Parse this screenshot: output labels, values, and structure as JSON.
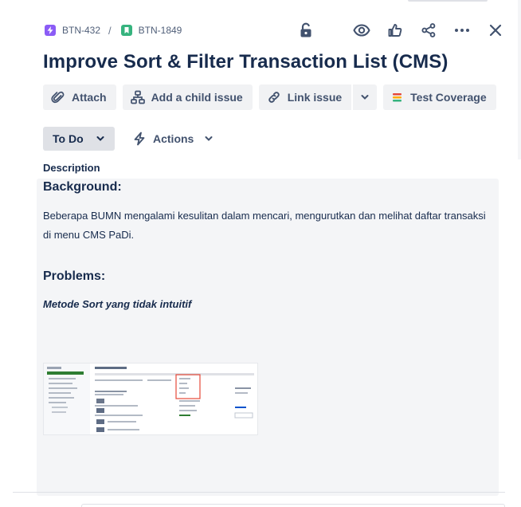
{
  "breadcrumbs": [
    {
      "key": "BTN-432",
      "type": "epic",
      "icon": "lightning-bolt-icon",
      "color": "#8b5cf6"
    },
    {
      "key": "BTN-1849",
      "type": "story",
      "icon": "bookmark-icon",
      "color": "#36b37e"
    }
  ],
  "breadcrumb_separator": "/",
  "top_actions": [
    "unlock-icon",
    "watch-eye-icon",
    "thumbs-up-icon",
    "share-icon",
    "more-icon",
    "close-icon"
  ],
  "issue": {
    "title": "Improve Sort & Filter Transaction List (CMS)"
  },
  "toolbar": {
    "attach_label": "Attach",
    "child_issue_label": "Add a child issue",
    "link_issue_label": "Link issue",
    "test_coverage_label": "Test Coverage"
  },
  "status": {
    "label": "To Do",
    "actions_label": "Actions"
  },
  "description": {
    "label": "Description",
    "background_heading": "Background:",
    "background_text": "Beberapa BUMN mengalami kesulitan dalam mencari, mengurutkan dan melihat daftar transaksi di menu CMS PaDi.",
    "problems_heading": "Problems:",
    "problem_1": "Metode Sort yang tidak intuitif"
  },
  "colors": {
    "text_primary": "#172b4d",
    "text_secondary": "#42526e",
    "button_bg": "#f1f2f4",
    "status_bg": "#dfe1e6",
    "description_bg": "#f4f5f7",
    "epic": "#8b5cf6",
    "story": "#36b37e",
    "highlight_red": "#e5493a"
  }
}
